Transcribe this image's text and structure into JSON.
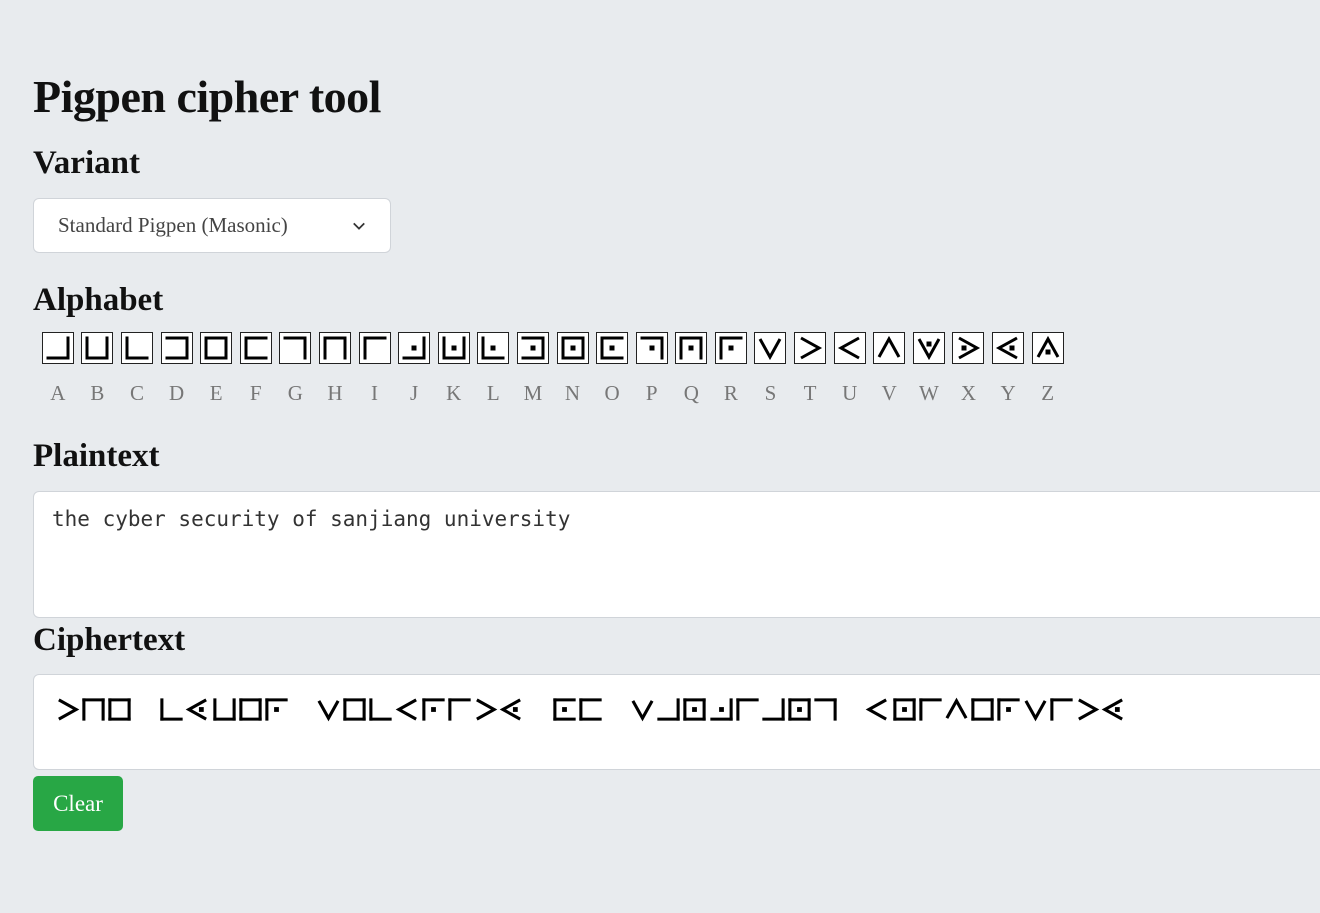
{
  "page": {
    "title": "Pigpen cipher tool"
  },
  "variant": {
    "label": "Variant",
    "selected": "Standard Pigpen (Masonic)"
  },
  "alphabet": {
    "label": "Alphabet",
    "letters": [
      "A",
      "B",
      "C",
      "D",
      "E",
      "F",
      "G",
      "H",
      "I",
      "J",
      "K",
      "L",
      "M",
      "N",
      "O",
      "P",
      "Q",
      "R",
      "S",
      "T",
      "U",
      "V",
      "W",
      "X",
      "Y",
      "Z"
    ]
  },
  "plaintext": {
    "label": "Plaintext",
    "value": "the cyber security of sanjiang university"
  },
  "ciphertext": {
    "label": "Ciphertext"
  },
  "buttons": {
    "clear": "Clear"
  },
  "icons": {
    "select_arrow": "chevron-down-icon"
  },
  "colors": {
    "clear_button": "#28a745",
    "background": "#e8ebee"
  }
}
